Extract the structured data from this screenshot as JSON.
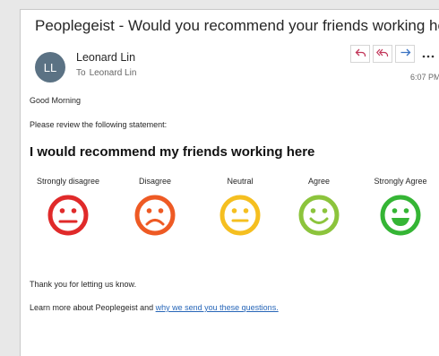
{
  "email": {
    "subject": "Peoplegeist - Would you recommend your friends working here?",
    "avatar_initials": "LL",
    "sender": "Leonard Lin",
    "to_label": "To",
    "to_name": "Leonard Lin",
    "time": "6:07 PM"
  },
  "actions": {
    "reply_icon": "reply-icon",
    "reply_all_icon": "reply-all-icon",
    "forward_icon": "forward-icon",
    "more_icon": "more-icon"
  },
  "body": {
    "greeting": "Good Morning",
    "prompt": "Please review the following statement:",
    "statement": "I would recommend my friends working here",
    "ratings": [
      {
        "label": "Strongly disagree",
        "color": "#e02a2a",
        "face": "frown"
      },
      {
        "label": "Disagree",
        "color": "#ee5a24",
        "face": "sad"
      },
      {
        "label": "Neutral",
        "color": "#f5bf20",
        "face": "neutral"
      },
      {
        "label": "Agree",
        "color": "#8cc43c",
        "face": "smile"
      },
      {
        "label": "Strongly Agree",
        "color": "#35b535",
        "face": "grin"
      }
    ],
    "thanks": "Thank you for letting us know.",
    "learn_more_prefix": "Learn more about Peoplegeist and ",
    "learn_more_link": "why we send you these questions."
  }
}
